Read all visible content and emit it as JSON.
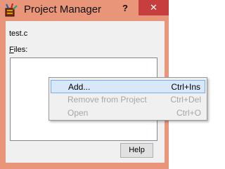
{
  "window": {
    "title": "Project Manager",
    "help_caption_button": "?",
    "close_button": "✕",
    "icon": "pencil-cup-app-icon"
  },
  "project": {
    "filename": "test.c",
    "files_label_access": "F",
    "files_label_rest": "iles:",
    "files": []
  },
  "help_button": "Help",
  "context_menu": {
    "items": [
      {
        "label": "Add...",
        "shortcut": "Ctrl+Ins",
        "enabled": true,
        "highlighted": true
      },
      {
        "label": "Remove from Project",
        "shortcut": "Ctrl+Del",
        "enabled": false,
        "highlighted": false
      },
      {
        "label": "Open",
        "shortcut": "Ctrl+O",
        "enabled": false,
        "highlighted": false
      }
    ]
  },
  "colors": {
    "window_frame": "#e9957a",
    "close_button": "#c73e3e",
    "menu_highlight": "#d9e8f9",
    "menu_highlight_border": "#78aee5",
    "disabled_text": "#a6a6a6"
  }
}
